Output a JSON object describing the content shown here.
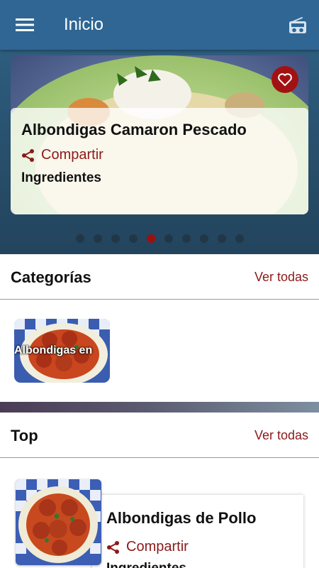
{
  "appbar": {
    "title": "Inicio",
    "menu_icon": "menu-icon",
    "radio_icon": "radio-icon"
  },
  "slider": {
    "title": "Albondigas Camaron Pescado",
    "share_label": "Compartir",
    "ingredients_label": "Ingredientes",
    "favorite_icon": "heart-icon",
    "total_pages": 10,
    "active_page": 5
  },
  "categories": {
    "heading": "Categorías",
    "see_all": "Ver todas",
    "items": [
      {
        "label": "Albondigas en"
      }
    ]
  },
  "top": {
    "heading": "Top",
    "see_all": "Ver todas",
    "items": [
      {
        "title": "Albondigas de Pollo",
        "share_label": "Compartir",
        "ingredients_label": "Ingredientes"
      }
    ]
  },
  "colors": {
    "appbar": "#2f6694",
    "accent": "#8b1a1a",
    "favorite": "#a31212"
  }
}
